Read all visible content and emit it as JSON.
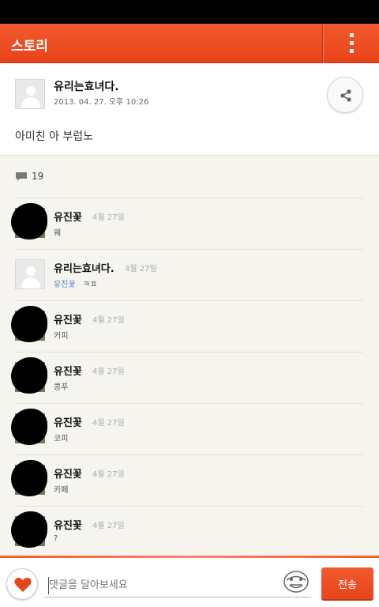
{
  "app_bar": {
    "title": "스토리",
    "menu_icon": "overflow-menu-icon"
  },
  "post": {
    "author": "유리는효녀다.",
    "date": "2013. 04. 27. 오후 10:26",
    "text": "아미친 아 부럽노",
    "share_icon": "share-icon"
  },
  "comments_count": {
    "icon": "comment-bubble-icon",
    "value": "19"
  },
  "comments": [
    {
      "name": "유진꽃",
      "date": "4월 27일",
      "text": "웨",
      "avatar": "photo"
    },
    {
      "name": "유리는효녀다.",
      "date": "4월 27일",
      "mention": "유진꽃",
      "text": "ㅋㅍ",
      "avatar": "default"
    },
    {
      "name": "유진꽃",
      "date": "4월 27일",
      "text": "커피",
      "avatar": "photo"
    },
    {
      "name": "유진꽃",
      "date": "4월 27일",
      "text": "콩푸",
      "avatar": "photo"
    },
    {
      "name": "유진꽃",
      "date": "4월 27일",
      "text": "코피",
      "avatar": "photo"
    },
    {
      "name": "유진꽃",
      "date": "4월 27일",
      "text": "카페",
      "avatar": "photo"
    },
    {
      "name": "유진꽃",
      "date": "4월 27일",
      "text": "?",
      "avatar": "photo"
    }
  ],
  "bottom_bar": {
    "input_placeholder": "댓글을 달아보세요",
    "send_label": "전송",
    "heart_icon": "heart-icon",
    "emoticon_icon": "emoticon-icon"
  },
  "colors": {
    "accent": "#f04e23",
    "heart": "#e8441c",
    "mention": "#4a7fc1"
  }
}
